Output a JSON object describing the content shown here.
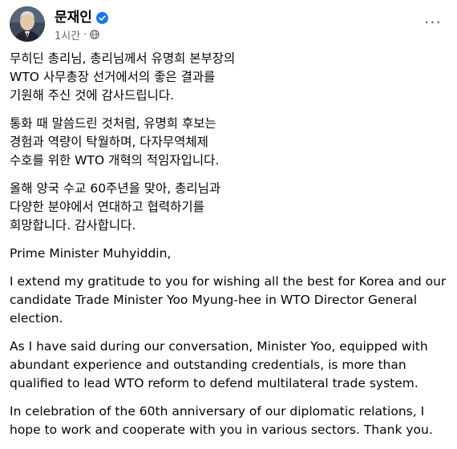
{
  "author": {
    "name": "문재인",
    "verified": true,
    "timestamp": "1시간",
    "privacy_icon": "globe-icon",
    "avatar_icon": "profile-avatar"
  },
  "more_button": {
    "label": "···",
    "icon": "more-options-icon"
  },
  "paragraphs": [
    "무히딘 총리님, 총리님께서 유명희 본부장의\nWTO 사무총장 선거에서의 좋은 결과를\n기원해 주신 것에 감사드립니다.",
    "통화 때 말씀드린 것처럼, 유명희 후보는\n경험과 역량이 탁월하며, 다자무역체제\n수호를 위한 WTO 개혁의 적임자입니다.",
    "올해 양국 수교 60주년을 맞아, 총리님과\n다양한 분야에서 연대하고 협력하기를\n희망합니다. 감사합니다.",
    "Prime Minister Muhyiddin,",
    "I extend my gratitude to you for wishing all the best for Korea and our\ncandidate Trade Minister Yoo Myung-hee in WTO Director General\nelection.",
    "As I have said during our conversation, Minister Yoo, equipped with\nabundant experience and outstanding credentials, is more than\nqualified to lead WTO reform to defend multilateral trade system.",
    "In celebration of the 60th anniversary of our diplomatic relations, I\nhope to work and cooperate with you in various sectors. Thank you."
  ],
  "colors": {
    "text": "#050505",
    "secondary": "#65676b",
    "verified_blue": "#1877f2"
  }
}
